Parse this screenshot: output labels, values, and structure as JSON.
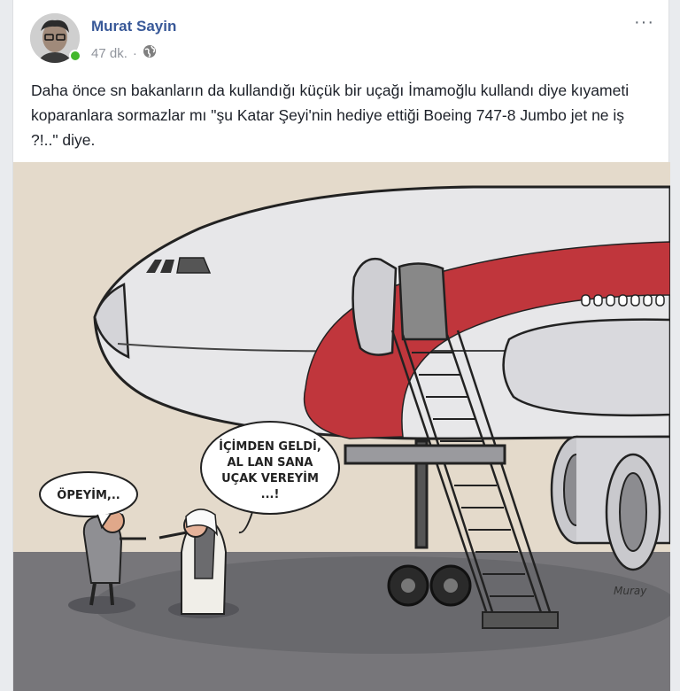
{
  "post": {
    "author_name": "Murat Sayin",
    "time": "47 dk.",
    "separator": "·",
    "more": "···",
    "text": "Daha önce sn bakanların da kullandığı küçük bir uçağı İmamoğlu kullandı diye kıyameti koparanlara sormazlar mı \"şu Katar Şeyi'nin hediye ettiği Boeing 747-8 Jumbo jet ne iş ?!..\" diye."
  },
  "icons": {
    "privacy": "globe-icon",
    "more": "more-options-icon",
    "presence": "online-status-dot"
  },
  "cartoon": {
    "bubble_left": "ÖPEYİM,..",
    "bubble_right_lines": [
      "İÇİMDEN GELDİ,",
      "AL LAN SANA",
      "UÇAK VEREYİM",
      "...!"
    ],
    "signature": "Muray"
  },
  "colors": {
    "author_link": "#385898",
    "stripe_red": "#c0363c",
    "online": "#42b72a"
  }
}
